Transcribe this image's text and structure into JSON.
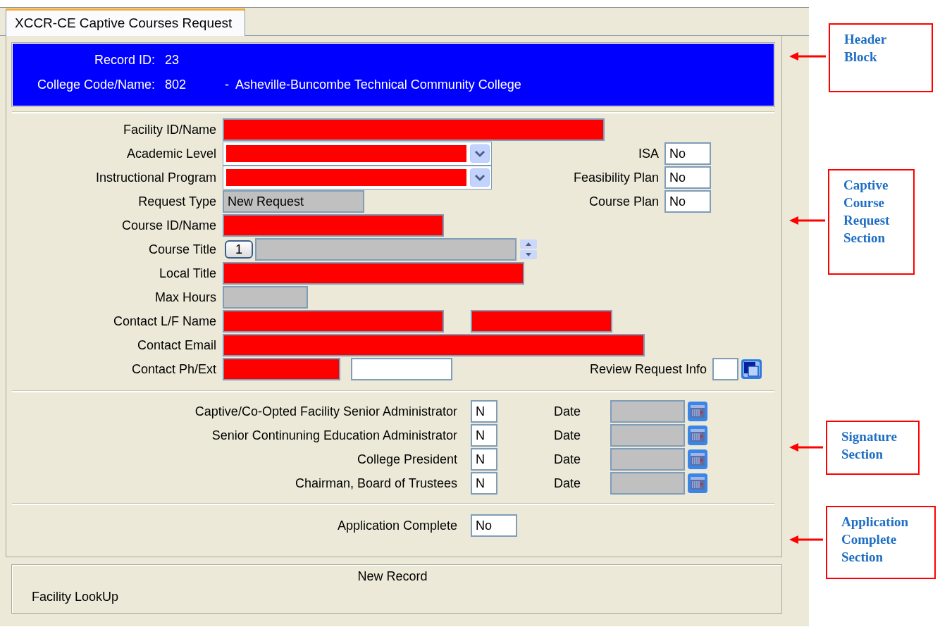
{
  "tab": {
    "label": "XCCR-CE Captive Courses Request",
    "selected": true
  },
  "header": {
    "record_id_label": "Record ID:",
    "record_id": "23",
    "college_label": "College Code/Name:",
    "college_code": "802",
    "separator": "-",
    "college_name": "Asheville-Buncombe Technical Community College"
  },
  "request": {
    "fields": [
      {
        "label": "Facility ID/Name",
        "kind": "text",
        "inputs": [
          {
            "required": true
          }
        ]
      },
      {
        "label": "Academic Level",
        "kind": "select",
        "inputs": [
          {
            "required": true
          }
        ],
        "side": {
          "kind": "text",
          "label": "ISA",
          "value": "No"
        }
      },
      {
        "label": "Instructional Program",
        "kind": "select",
        "inputs": [
          {
            "required": true
          }
        ],
        "side": {
          "kind": "text",
          "label": "Feasibility Plan",
          "value": "No"
        }
      },
      {
        "label": "Request Type",
        "kind": "readonly",
        "value": "New Request",
        "side": {
          "kind": "text",
          "label": "Course Plan",
          "value": "No"
        }
      },
      {
        "label": "Course ID/Name",
        "kind": "text",
        "inputs": [
          {
            "required": true
          }
        ]
      },
      {
        "label": "Course Title",
        "kind": "spin",
        "index": "1"
      },
      {
        "label": "Local Title",
        "kind": "text",
        "inputs": [
          {
            "required": true
          }
        ]
      },
      {
        "label": "Max Hours",
        "kind": "readonly"
      },
      {
        "label": "Contact L/F Name",
        "kind": "text",
        "inputs": [
          {
            "required": true
          },
          {
            "required": true
          }
        ]
      },
      {
        "label": "Contact Email",
        "kind": "text",
        "inputs": [
          {
            "required": true
          }
        ]
      },
      {
        "label": "Contact Ph/Ext",
        "kind": "text",
        "inputs": [
          {
            "required": true
          },
          {
            "required": false
          }
        ],
        "side": {
          "kind": "lookup",
          "label": "Review Request Info"
        }
      }
    ]
  },
  "signatures": [
    {
      "label": "Captive/Co-Opted Facility Senior Administrator",
      "value": "N",
      "date_label": "Date"
    },
    {
      "label": "Senior Continuning Education Administrator",
      "value": "N",
      "date_label": "Date"
    },
    {
      "label": "College President",
      "value": "N",
      "date_label": "Date"
    },
    {
      "label": "Chairman, Board of Trustees",
      "value": "N",
      "date_label": "Date"
    }
  ],
  "completion": {
    "label": "Application Complete",
    "value": "No"
  },
  "status": {
    "message": "New Record",
    "hint": "Facility LookUp"
  },
  "annotations": [
    {
      "lines": [
        "Header",
        "Block"
      ]
    },
    {
      "lines": [
        "Captive",
        "Course",
        "Request",
        "Section"
      ]
    },
    {
      "lines": [
        "Signature",
        "Section"
      ]
    },
    {
      "lines": [
        "Application",
        "Complete",
        "Section"
      ]
    }
  ]
}
